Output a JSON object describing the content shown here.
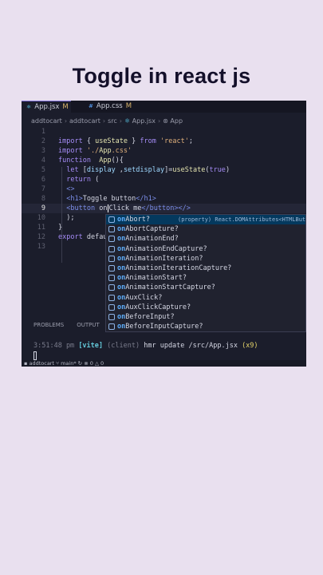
{
  "title": "Toggle in react js",
  "tabs": [
    {
      "label": "App.jsx",
      "modified": "M"
    },
    {
      "label": "App.css",
      "modified": "M"
    }
  ],
  "breadcrumb": [
    "addtocart",
    "addtocart",
    "src",
    "App.jsx",
    "App"
  ],
  "code_lines": [
    {
      "n": "1",
      "text": ""
    },
    {
      "n": "2",
      "text": "import { useState } from 'react';"
    },
    {
      "n": "3",
      "text": "import './App.css'"
    },
    {
      "n": "4",
      "text": "function  App(){"
    },
    {
      "n": "5",
      "text": "  let [display ,setdisplay]=useState(true)"
    },
    {
      "n": "6",
      "text": "  return ("
    },
    {
      "n": "7",
      "text": "  <>"
    },
    {
      "n": "8",
      "text": "  <h1>Toggle button</h1>"
    },
    {
      "n": "9",
      "text": "  <button on|Click me</button></>"
    },
    {
      "n": "10",
      "text": "  );"
    },
    {
      "n": "11",
      "text": "}"
    },
    {
      "n": "12",
      "text": "export defau"
    },
    {
      "n": "13",
      "text": ""
    }
  ],
  "suggestions": [
    {
      "prefix": "on",
      "rest": "Abort?",
      "detail": "(property) React.DOMAttributes<HTMLButt"
    },
    {
      "prefix": "on",
      "rest": "AbortCapture?"
    },
    {
      "prefix": "on",
      "rest": "AnimationEnd?"
    },
    {
      "prefix": "on",
      "rest": "AnimationEndCapture?"
    },
    {
      "prefix": "on",
      "rest": "AnimationIteration?"
    },
    {
      "prefix": "on",
      "rest": "AnimationIterationCapture?"
    },
    {
      "prefix": "on",
      "rest": "AnimationStart?"
    },
    {
      "prefix": "on",
      "rest": "AnimationStartCapture?"
    },
    {
      "prefix": "on",
      "rest": "AuxClick?"
    },
    {
      "prefix": "on",
      "rest": "AuxClickCapture?"
    },
    {
      "prefix": "on",
      "rest": "BeforeInput?"
    },
    {
      "prefix": "on",
      "rest": "BeforeInputCapture?"
    }
  ],
  "panel": {
    "problems": "PROBLEMS",
    "output": "OUTPUT"
  },
  "terminal": {
    "time": "3:51:48 pm",
    "vite": "[vite]",
    "client": "(client)",
    "message": "hmr update /src/App.jsx",
    "count": "(x9)"
  },
  "status": {
    "folder": "addtocart",
    "branch": "main*",
    "errors": "0",
    "warnings": "0"
  }
}
